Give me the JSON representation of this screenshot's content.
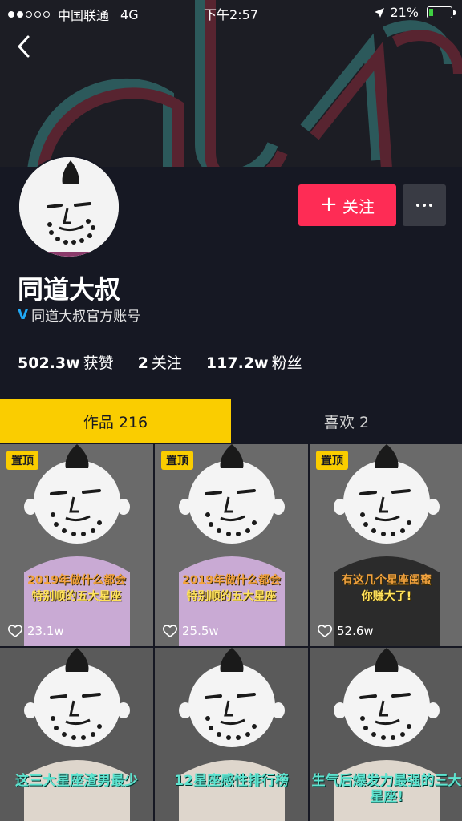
{
  "status_bar": {
    "carrier": "中国联通",
    "network": "4G",
    "time": "下午2:57",
    "battery_percent": "21%",
    "battery_level": 0.21
  },
  "header": {
    "back_icon": "chevron-left-icon"
  },
  "profile": {
    "follow_label": "关注",
    "follow_icon": "plus-icon",
    "more_icon": "ellipsis-icon",
    "name": "同道大叔",
    "verified_text": "同道大叔官方账号",
    "verified_icon": "verified-v-icon",
    "stats": {
      "likes_num": "502.3w",
      "likes_label": "获赞",
      "following_num": "2",
      "following_label": "关注",
      "fans_num": "117.2w",
      "fans_label": "粉丝"
    }
  },
  "tabs": {
    "works": "作品 216",
    "likes": "喜欢 2"
  },
  "videos": [
    {
      "pinned": "置顶",
      "caption_l1": "2019年做什么都会",
      "caption_l2": "特别顺的五大星座",
      "likes": "23.1w",
      "shirt": "#c9aad4"
    },
    {
      "pinned": "置顶",
      "caption_l1": "2019年做什么都会",
      "caption_l2": "特别顺的五大星座",
      "likes": "25.5w",
      "shirt": "#c9aad4"
    },
    {
      "pinned": "置顶",
      "caption_l1": "有这几个星座闺蜜",
      "caption_l2": "你赚大了!",
      "likes": "52.6w",
      "shirt": "#2b2b2b"
    },
    {
      "caption": "这三大星座渣男最少",
      "shirt": "#ded6cc"
    },
    {
      "caption": "12星座感性排行榜",
      "shirt": "#ded6cc"
    },
    {
      "caption": "生气后爆发力最强的三大星座!",
      "shirt": "#ded6cc"
    }
  ],
  "colors": {
    "accent_red": "#fe2c55",
    "accent_yellow": "#facd00",
    "background": "#161823"
  }
}
